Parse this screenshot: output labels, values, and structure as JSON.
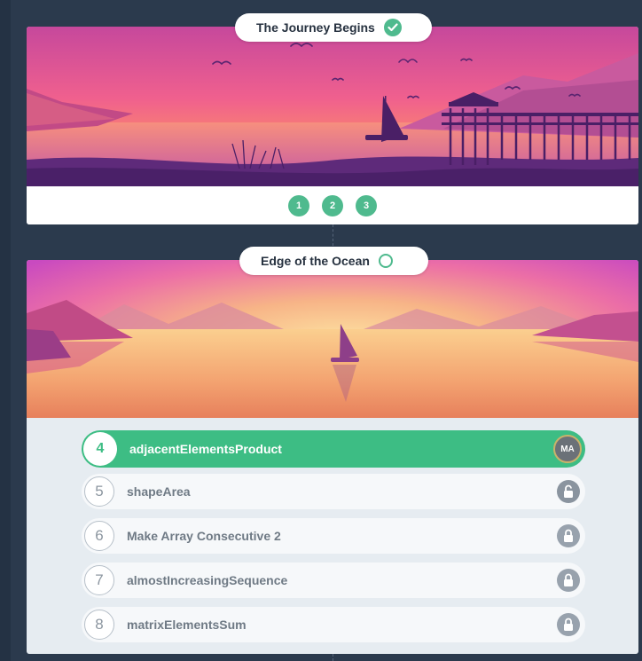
{
  "colors": {
    "accent": "#3dbd84",
    "background": "#2b3a4d"
  },
  "chapters": [
    {
      "title": "The Journey Begins",
      "status": "completed",
      "status_icon": "check-circle-icon",
      "steps": [
        "1",
        "2",
        "3"
      ]
    },
    {
      "title": "Edge of the Ocean",
      "status": "in-progress",
      "status_icon": "empty-circle-icon",
      "tasks": [
        {
          "num": "4",
          "name": "adjacentElementsProduct",
          "state": "active",
          "avatar": "MA"
        },
        {
          "num": "5",
          "name": "shapeArea",
          "state": "unlocked",
          "icon": "unlocked-lock-icon"
        },
        {
          "num": "6",
          "name": "Make Array Consecutive 2",
          "state": "locked",
          "icon": "lock-icon"
        },
        {
          "num": "7",
          "name": "almostIncreasingSequence",
          "state": "locked",
          "icon": "lock-icon"
        },
        {
          "num": "8",
          "name": "matrixElementsSum",
          "state": "locked",
          "icon": "lock-icon"
        }
      ]
    }
  ]
}
